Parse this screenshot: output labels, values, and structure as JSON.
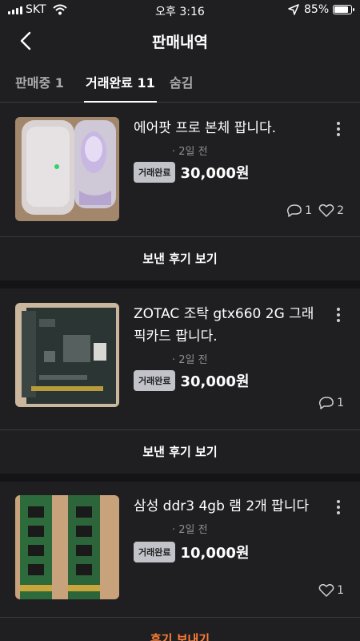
{
  "status_bar": {
    "carrier": "SKT",
    "time": "오후 3:16",
    "battery": "85%"
  },
  "nav": {
    "title": "판매내역"
  },
  "tabs": [
    {
      "label": "판매중 1"
    },
    {
      "label": "거래완료 11"
    },
    {
      "label": "숨김"
    }
  ],
  "items": [
    {
      "title": "에어팟 프로 본체 팝니다.",
      "time": "· 2일 전",
      "badge": "거래완료",
      "price": "30,000원",
      "chats": "1",
      "likes": "2",
      "action": "보낸 후기 보기"
    },
    {
      "title": "ZOTAC 조탁 gtx660 2G 그래픽카드 팝니다.",
      "time": "· 2일 전",
      "badge": "거래완료",
      "price": "30,000원",
      "chats": "1",
      "action": "보낸 후기 보기"
    },
    {
      "title": "삼성 ddr3 4gb 램 2개 팝니다",
      "time": "· 2일 전",
      "badge": "거래완료",
      "price": "10,000원",
      "likes": "1",
      "action": "후기 보내기"
    }
  ],
  "colors": {
    "background": "#1f1f21",
    "accent": "#ff7e36",
    "badge": "#c2c3c8"
  }
}
